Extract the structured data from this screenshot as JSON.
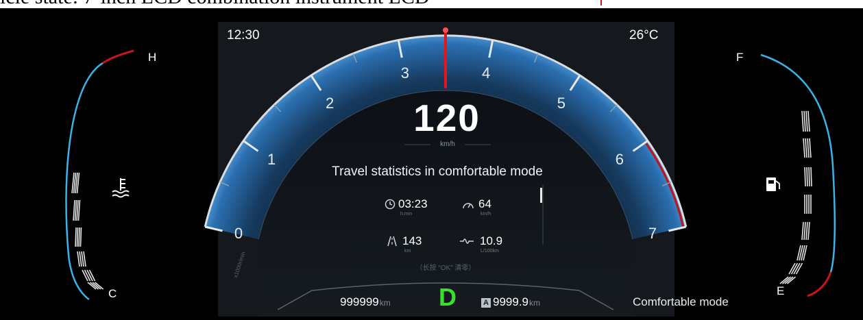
{
  "caption": "icle state: 7-inch LCD combination instrument LCD",
  "header": {
    "time": "12:30",
    "temperature": "26°C"
  },
  "speed": {
    "value": "120",
    "unit": "km/h"
  },
  "tach": {
    "labels": [
      "0",
      "1",
      "2",
      "3",
      "4",
      "5",
      "6",
      "7"
    ],
    "unit": "x1000r/min",
    "needle_rpm": 3.5,
    "redline_from_rpm": 6
  },
  "stats": {
    "title": "Travel statistics in comfortable mode",
    "time": {
      "value": "03:23",
      "unit": "h:min"
    },
    "avg_speed": {
      "value": "64",
      "unit": "km/h"
    },
    "distance": {
      "value": "143",
      "unit": "km"
    },
    "consumption": {
      "value": "10.9",
      "unit": "L/100km"
    },
    "reset_hint": "（长按 “OK” 清零）"
  },
  "bottom": {
    "odometer": {
      "value": "999999",
      "unit": "km"
    },
    "gear": "D",
    "trip": {
      "badge": "A",
      "value": "9999.9",
      "unit": "km"
    }
  },
  "mode_label": "Comfortable mode",
  "temp_gauge": {
    "high": "H",
    "low": "C"
  },
  "fuel_gauge": {
    "full": "F",
    "empty": "E"
  },
  "colors": {
    "needle": "#e8141c",
    "arc": "#2a6aa8",
    "gear": "#3adf2e",
    "gauge_blue": "#3ab4e6",
    "gauge_red": "#c8141c"
  },
  "icons": [
    "coolant-temperature-icon",
    "fuel-pump-icon",
    "clock-icon",
    "speedometer-icon",
    "road-icon",
    "fuel-consumption-icon"
  ]
}
